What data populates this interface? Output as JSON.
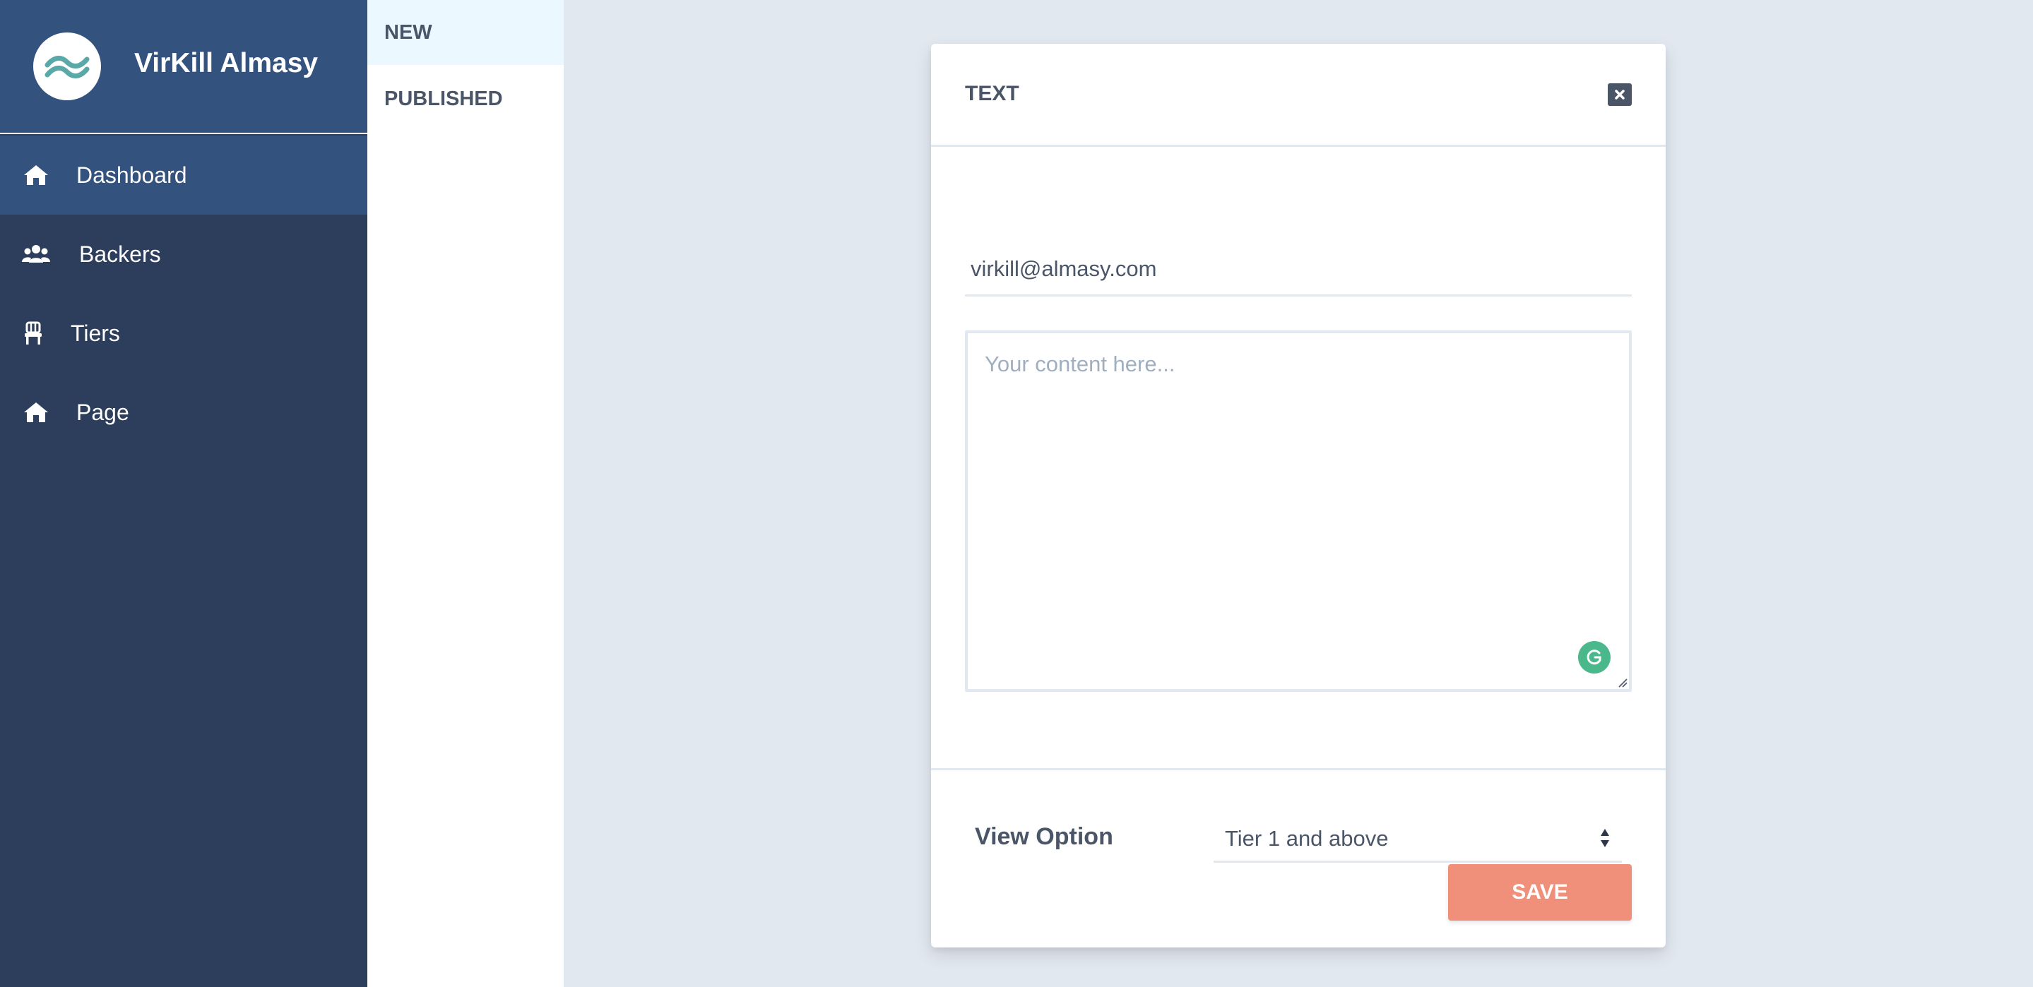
{
  "brand": {
    "name": "VirKill Almasy",
    "logo_icon": "wave-logo-icon"
  },
  "sidebar": {
    "items": [
      {
        "label": "Dashboard",
        "icon": "home-icon",
        "active": true
      },
      {
        "label": "Backers",
        "icon": "users-icon",
        "active": false
      },
      {
        "label": "Tiers",
        "icon": "chair-icon",
        "active": false
      },
      {
        "label": "Page",
        "icon": "home-icon",
        "active": false
      }
    ]
  },
  "subnav": {
    "tabs": [
      {
        "label": "NEW",
        "active": true
      },
      {
        "label": "PUBLISHED",
        "active": false
      }
    ]
  },
  "modal": {
    "title": "TEXT",
    "email_value": "virkill@almasy.com",
    "content_placeholder": "Your content here...",
    "view_option_label": "View Option",
    "view_option_value": "Tier 1 and above",
    "save_label": "SAVE"
  },
  "colors": {
    "sidebar_bg": "#2c3e5c",
    "sidebar_active": "#34527e",
    "accent_save": "#f0907a",
    "grammarly": "#4bb88b",
    "page_bg": "#e2e8f0"
  }
}
